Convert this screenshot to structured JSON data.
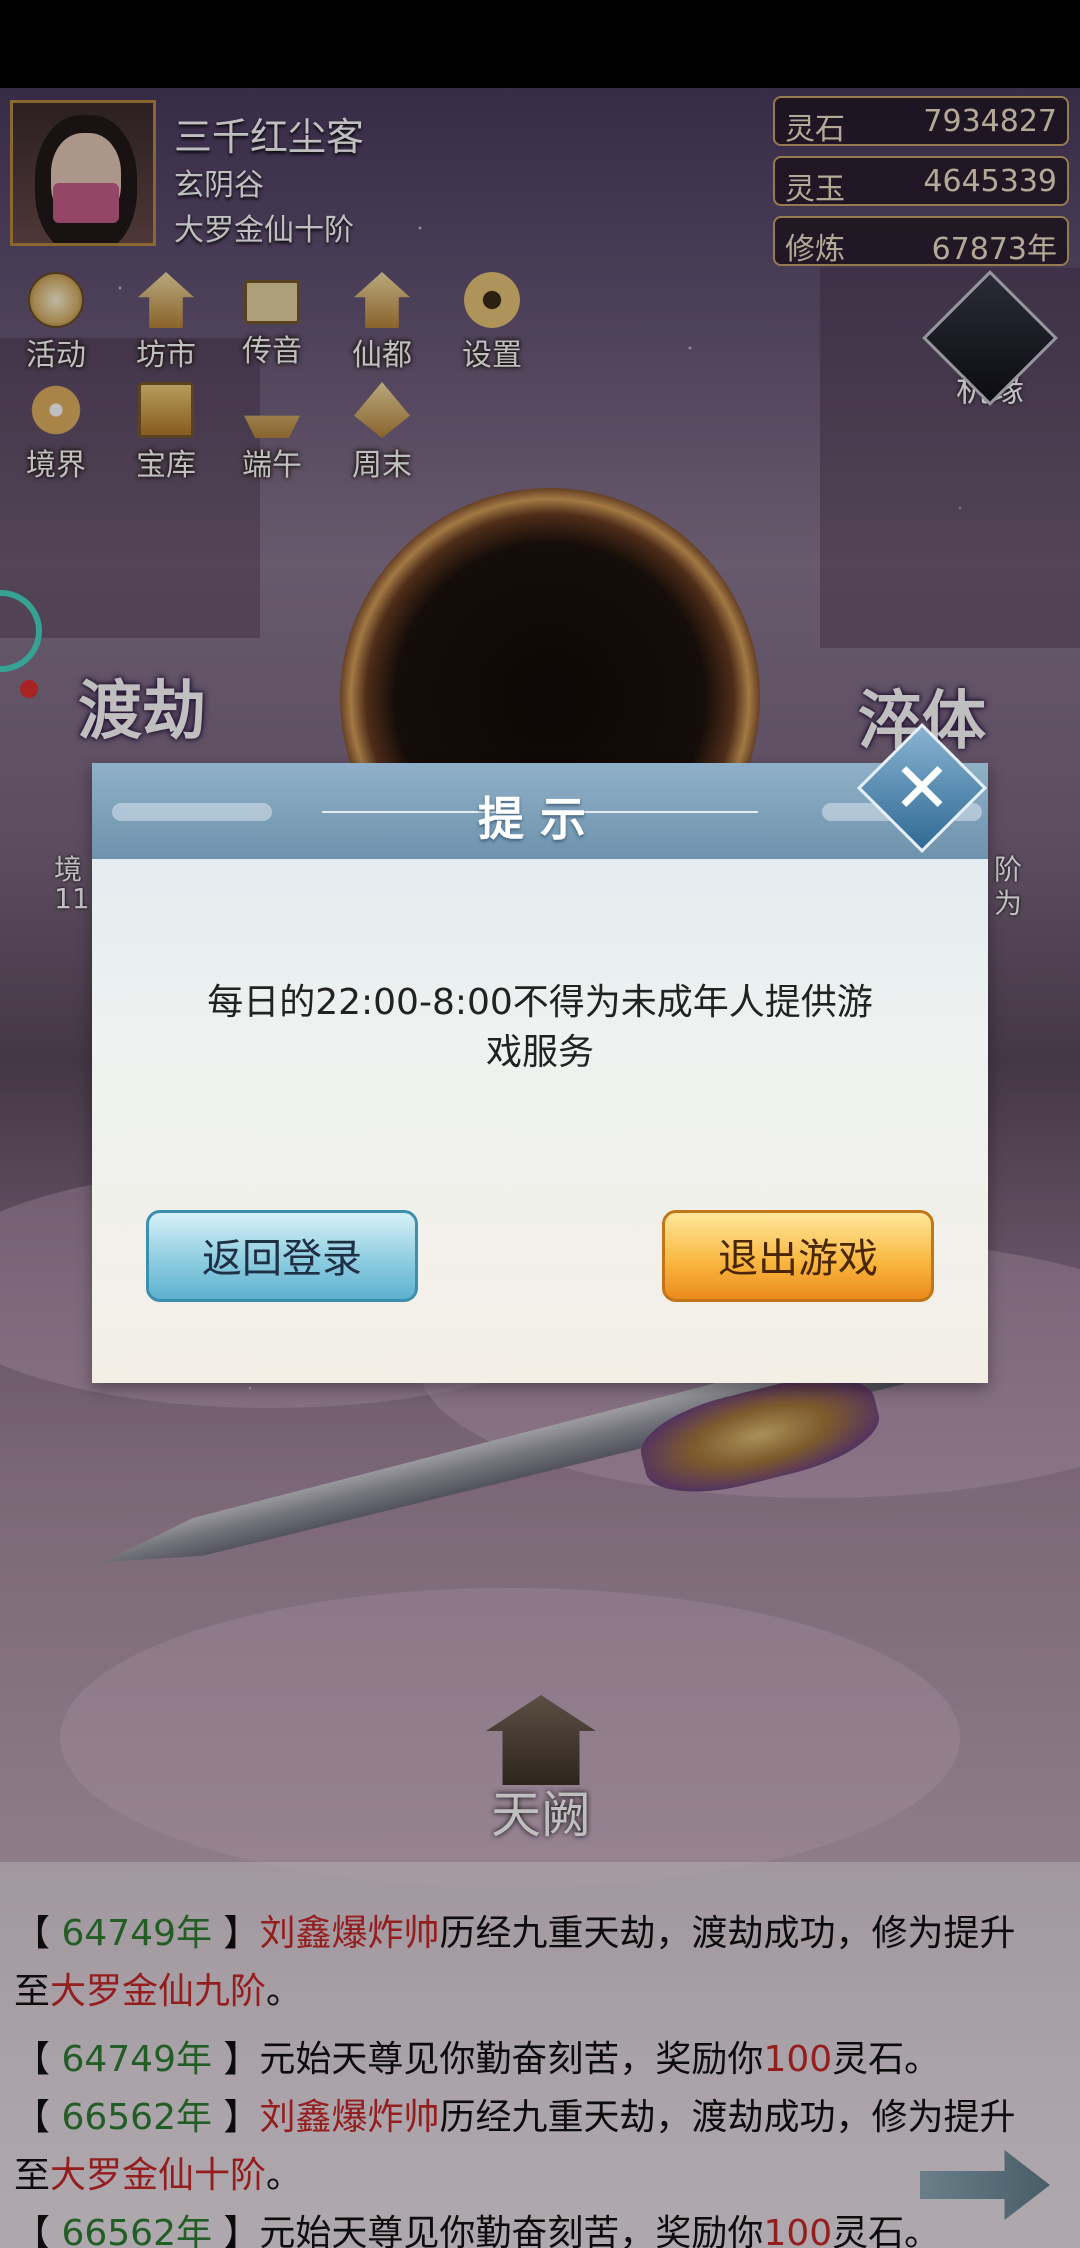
{
  "player": {
    "name": "三千红尘客",
    "sect": "玄阴谷",
    "realm": "大罗金仙十阶"
  },
  "resources": [
    {
      "label": "灵石",
      "value": "7934827"
    },
    {
      "label": "灵玉",
      "value": "4645339"
    },
    {
      "label": "修炼",
      "value": "67873年"
    }
  ],
  "menu_row1": [
    {
      "label": "活动",
      "icon": "coin-icon"
    },
    {
      "label": "坊市",
      "icon": "market-icon"
    },
    {
      "label": "传音",
      "icon": "letter-icon"
    },
    {
      "label": "仙都",
      "icon": "city-icon"
    },
    {
      "label": "设置",
      "icon": "gear-icon"
    }
  ],
  "menu_row2": [
    {
      "label": "境界",
      "icon": "pinwheel-icon"
    },
    {
      "label": "宝库",
      "icon": "treasure-icon"
    },
    {
      "label": "端午",
      "icon": "boat-icon"
    },
    {
      "label": "周末",
      "icon": "leaf-icon"
    }
  ],
  "jiyuan_label": "机缘",
  "left_big": "渡劫",
  "right_big": "淬体",
  "left_info": {
    "line1": "境",
    "line2": "11"
  },
  "right_info": {
    "line1": "阶",
    "line2": "为"
  },
  "tiange_label": "天阙",
  "dialog": {
    "title": "提示",
    "message_line1": "每日的22:00-8:00不得为未成年人提供游",
    "message_line2": "戏服务",
    "login_button": "返回登录",
    "exit_button": "退出游戏",
    "close_symbol": "✕"
  },
  "log": [
    {
      "parts": [
        {
          "t": "【 "
        },
        {
          "t": "64749年",
          "c": "g"
        },
        {
          "t": " 】"
        },
        {
          "t": "刘鑫爆炸帅",
          "c": "r"
        },
        {
          "t": "历经九重天劫，渡劫成功，修为提升"
        }
      ]
    },
    {
      "parts": [
        {
          "t": "至"
        },
        {
          "t": "大罗金仙九阶",
          "c": "r"
        },
        {
          "t": "。"
        }
      ]
    },
    {
      "parts": [
        {
          "t": "【 "
        },
        {
          "t": "64749年",
          "c": "g"
        },
        {
          "t": " 】元始天尊见你勤奋刻苦，奖励你"
        },
        {
          "t": "100",
          "c": "r"
        },
        {
          "t": "灵石。"
        }
      ]
    },
    {
      "parts": [
        {
          "t": "【 "
        },
        {
          "t": "66562年",
          "c": "g"
        },
        {
          "t": " 】"
        },
        {
          "t": "刘鑫爆炸帅",
          "c": "r"
        },
        {
          "t": "历经九重天劫，渡劫成功，修为提升"
        }
      ]
    },
    {
      "parts": [
        {
          "t": "至"
        },
        {
          "t": "大罗金仙十阶",
          "c": "r"
        },
        {
          "t": "。"
        }
      ]
    },
    {
      "parts": [
        {
          "t": "【 "
        },
        {
          "t": "66562年",
          "c": "g"
        },
        {
          "t": " 】元始天尊见你勤奋刻苦，奖励你"
        },
        {
          "t": "100",
          "c": "r"
        },
        {
          "t": "灵石。"
        }
      ]
    }
  ]
}
